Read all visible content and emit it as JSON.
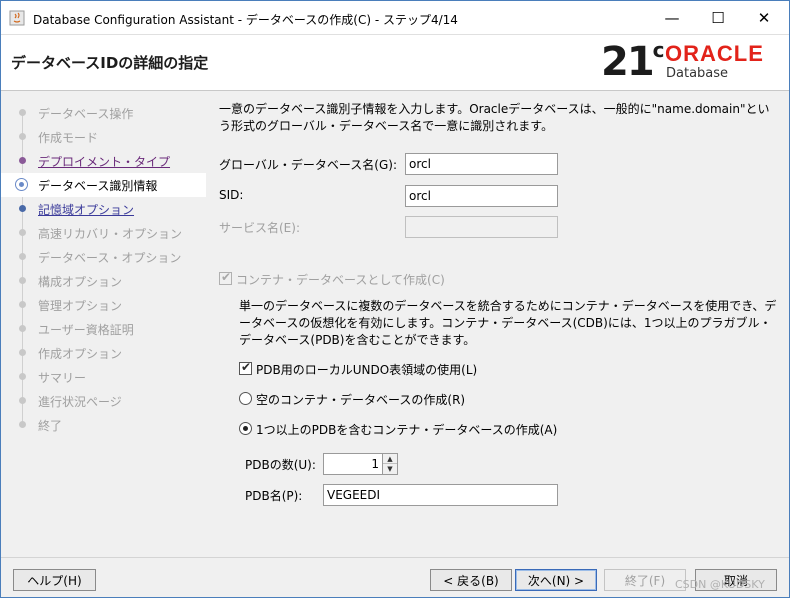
{
  "window": {
    "title": "Database Configuration Assistant - データベースの作成(C) - ステップ4/14",
    "minimize": "—",
    "maximize": "☐",
    "close": "✕"
  },
  "header": {
    "page_title": "データベースIDの詳細の指定",
    "logo_version": "21",
    "logo_sup": "c",
    "logo_brand": "ORACLE",
    "logo_product": "Database"
  },
  "sidebar": {
    "steps": [
      {
        "label": "データベース操作",
        "state": "disabled"
      },
      {
        "label": "作成モード",
        "state": "disabled"
      },
      {
        "label": "デプロイメント・タイプ",
        "state": "visited"
      },
      {
        "label": "データベース識別情報",
        "state": "current"
      },
      {
        "label": "記憶域オプション",
        "state": "link"
      },
      {
        "label": "高速リカバリ・オプション",
        "state": "disabled"
      },
      {
        "label": "データベース・オプション",
        "state": "disabled"
      },
      {
        "label": "構成オプション",
        "state": "disabled"
      },
      {
        "label": "管理オプション",
        "state": "disabled"
      },
      {
        "label": "ユーザー資格証明",
        "state": "disabled"
      },
      {
        "label": "作成オプション",
        "state": "disabled"
      },
      {
        "label": "サマリー",
        "state": "disabled"
      },
      {
        "label": "進行状況ページ",
        "state": "disabled"
      },
      {
        "label": "終了",
        "state": "disabled"
      }
    ]
  },
  "main": {
    "intro": "一意のデータベース識別子情報を入力します。Oracleデータベースは、一般的に\"name.domain\"という形式のグローバル・データベース名で一意に識別されます。",
    "global_db_name_label": "グローバル・データベース名(G):",
    "global_db_name_value": "orcl",
    "sid_label": "SID:",
    "sid_value": "orcl",
    "service_name_label": "サービス名(E):",
    "service_name_value": "",
    "container_db_label": "コンテナ・データベースとして作成(C)",
    "container_desc": "単一のデータベースに複数のデータベースを統合するためにコンテナ・データベースを使用でき、データベースの仮想化を有効にします。コンテナ・データベース(CDB)には、1つ以上のプラガブル・データベース(PDB)を含むことができます。",
    "local_undo_label": "PDB用のローカルUNDO表領域の使用(L)",
    "empty_cdb_label": "空のコンテナ・データベースの作成(R)",
    "cdb_with_pdb_label": "1つ以上のPDBを含むコンテナ・データベースの作成(A)",
    "pdb_count_label": "PDBの数(U):",
    "pdb_count_value": "1",
    "pdb_name_label": "PDB名(P):",
    "pdb_name_value": "VEGEEDI"
  },
  "buttons": {
    "help": "ヘルプ(H)",
    "back": "< 戻る(B)",
    "next": "次へ(N) >",
    "finish": "終了(F)",
    "cancel": "取消"
  },
  "watermark": "CSDN @KUDSKY"
}
